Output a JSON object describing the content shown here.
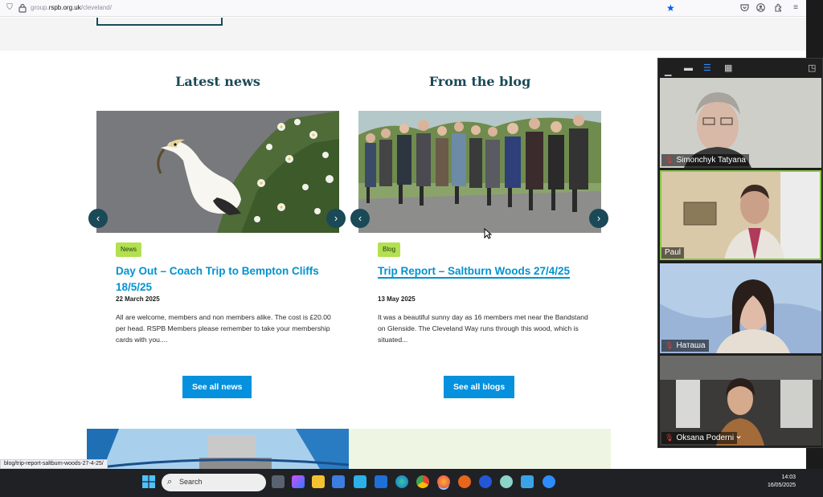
{
  "browser": {
    "url_prefix": "group.",
    "url_domain": "rspb.org.uk",
    "url_path": "/cleveland/"
  },
  "news": {
    "heading": "Latest news",
    "tag": "News",
    "title": "Day Out – Coach Trip to Bempton Cliffs 18/5/25",
    "date": "22 March 2025",
    "excerpt": "All are welcome, members and non members alike. The cost is £20.00 per head. RSPB Members please remember to take your membership cards with you....",
    "button": "See all news"
  },
  "blog": {
    "heading": "From the blog",
    "tag": "Blog",
    "title": "Trip Report – Saltburn Woods 27/4/25",
    "date": "13 May 2025",
    "excerpt": "It was a beautiful sunny day as 16 members met near the Bandstand on Glenside. The Cleveland Way runs through this wood, which is situated...",
    "button": "See all blogs"
  },
  "status_url": "blog/trip-report-saltburn-woods-27-4-25/",
  "zoom": {
    "participants": [
      {
        "name": "Simonchyk Tatyana",
        "muted": true
      },
      {
        "name": "Paul",
        "muted": false
      },
      {
        "name": "Наташа",
        "muted": true
      },
      {
        "name": "Oksana Poderni",
        "muted": true
      }
    ]
  },
  "taskbar": {
    "search_placeholder": "Search",
    "time": "14:03",
    "date": "16/05/2025"
  },
  "icons": {
    "prev": "‹",
    "next": "›",
    "mic_muted": "🎙"
  },
  "colors": {
    "brand_dark": "#1a4957",
    "link_blue": "#0093d0",
    "button_blue": "#0591de",
    "tag_green": "#b3e04f"
  }
}
